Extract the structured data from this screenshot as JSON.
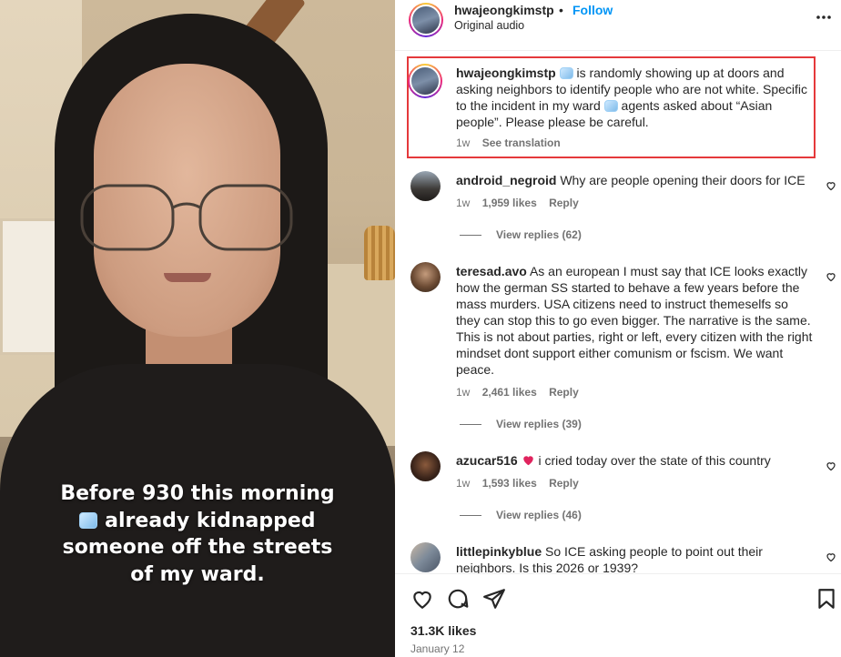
{
  "post": {
    "username": "hwajeongkimstp",
    "follow_label": "Follow",
    "separator": "•",
    "subtitle": "Original audio",
    "more_icon": "more-horizontal-icon",
    "caption_lines": [
      "Before 930 this morning",
      "already kidnapped",
      "someone off the streets",
      "of my ward."
    ]
  },
  "comments": [
    {
      "username": "hwajeongkimstp",
      "text_a": "is randomly showing up at doors and asking neighbors to identify people who are not white. Specific to the incident in my ward",
      "text_b": "agents asked about “Asian people”. Please please be careful.",
      "time": "1w",
      "action": "See translation"
    },
    {
      "username": "android_negroid",
      "text": "Why are people opening their doors for ICE",
      "time": "1w",
      "likes": "1,959 likes",
      "reply": "Reply",
      "view_replies": "View replies (62)"
    },
    {
      "username": "teresad.avo",
      "text": "As an european I must say that ICE looks exactly how the german SS started to behave a few years before the mass murders. USA citizens need to instruct themeselfs so they can stop this to go even bigger. The narrative is the same. This is not about parties, right or left, every citizen with the right mindset dont support either comunism or fscism. We want peace.",
      "time": "1w",
      "likes": "2,461 likes",
      "reply": "Reply",
      "view_replies": "View replies (39)"
    },
    {
      "username": "azucar516",
      "text": "i cried today over the state of this country",
      "time": "1w",
      "likes": "1,593 likes",
      "reply": "Reply",
      "view_replies": "View replies (46)"
    },
    {
      "username": "littlepinkyblue",
      "text": "So ICE asking people to point out their neighbors. Is this 2026 or 1939?"
    }
  ],
  "footer": {
    "likes": "31.3K likes",
    "date": "January 12"
  },
  "colors": {
    "follow": "#0095f6",
    "highlight_border": "#e5393b",
    "heart_emoji": "#e0245e"
  }
}
